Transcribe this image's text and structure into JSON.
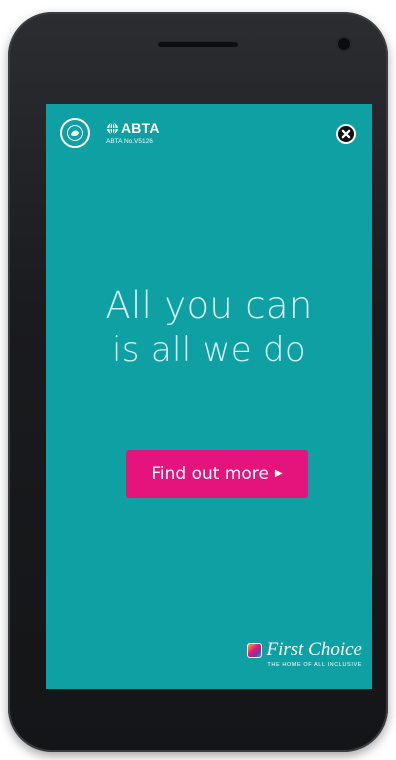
{
  "header": {
    "abta_brand": "ABTA",
    "abta_number": "ABTA No.V5126",
    "cert_logo_icon": "certification-seal-icon",
    "abta_icon": "abta-globe-icon",
    "close_icon": "close-x-icon"
  },
  "hero": {
    "headline_line1": "All you can",
    "headline_line2": "is all we do"
  },
  "cta": {
    "label": "Find out more",
    "arrow_icon": "triangle-right-icon"
  },
  "brand": {
    "name": "First Choice",
    "tagline": "THE HOME OF ALL INCLUSIVE",
    "logo_icon": "first-choice-flag-icon"
  },
  "colors": {
    "background": "#0fa0a3",
    "cta": "#e4147c",
    "headline": "#d6f2f3",
    "device": "#1a1b1e"
  }
}
